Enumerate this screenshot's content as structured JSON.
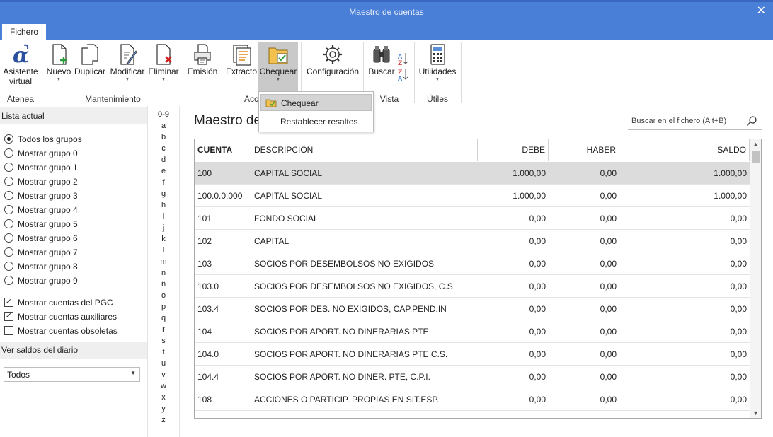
{
  "window": {
    "title": "Maestro de cuentas",
    "close_glyph": "✕"
  },
  "tabs": [
    {
      "label": "Fichero"
    }
  ],
  "ribbon": {
    "groups": {
      "atenea": "Atenea",
      "mantenimiento": "Mantenimiento",
      "acciones": "Acc",
      "vista": "Vista",
      "utiles": "Útiles"
    },
    "buttons": {
      "asistente_line1": "Asistente",
      "asistente_line2": "virtual",
      "nuevo": "Nuevo",
      "duplicar": "Duplicar",
      "modificar": "Modificar",
      "eliminar": "Eliminar",
      "emision": "Emisión",
      "extracto": "Extracto",
      "chequear": "Chequear",
      "configuracion": "Configuración",
      "buscar": "Buscar",
      "utilidades": "Utilidades"
    },
    "dropdown_arrow": "▼"
  },
  "chequear_menu": {
    "items": [
      "Chequear",
      "Restablecer resaltes"
    ]
  },
  "left_panel": {
    "lista_header": "Lista actual",
    "radios": [
      {
        "label": "Todos los grupos",
        "selected": true
      },
      {
        "label": "Mostrar grupo 0",
        "selected": false
      },
      {
        "label": "Mostrar grupo 1",
        "selected": false
      },
      {
        "label": "Mostrar grupo 2",
        "selected": false
      },
      {
        "label": "Mostrar grupo 3",
        "selected": false
      },
      {
        "label": "Mostrar grupo 4",
        "selected": false
      },
      {
        "label": "Mostrar grupo 5",
        "selected": false
      },
      {
        "label": "Mostrar grupo 6",
        "selected": false
      },
      {
        "label": "Mostrar grupo 7",
        "selected": false
      },
      {
        "label": "Mostrar grupo 8",
        "selected": false
      },
      {
        "label": "Mostrar grupo 9",
        "selected": false
      }
    ],
    "checks": [
      {
        "label": "Mostrar cuentas del PGC",
        "checked": true
      },
      {
        "label": "Mostrar cuentas auxiliares",
        "checked": true
      },
      {
        "label": "Mostrar cuentas obsoletas",
        "checked": false
      }
    ],
    "check_mark": "✓",
    "saldos_header": "Ver saldos del diario",
    "saldos_value": "Todos",
    "select_arrow": "▼"
  },
  "alphabet": [
    "0-9",
    "a",
    "b",
    "c",
    "d",
    "e",
    "f",
    "g",
    "h",
    "i",
    "j",
    "k",
    "l",
    "m",
    "n",
    "ñ",
    "o",
    "p",
    "q",
    "r",
    "s",
    "t",
    "u",
    "v",
    "w",
    "x",
    "y",
    "z"
  ],
  "main": {
    "title": "Maestro de",
    "search_placeholder": "Buscar en el fichero (Alt+B)"
  },
  "table": {
    "columns": [
      "CUENTA",
      "DESCRIPCIÓN",
      "DEBE",
      "HABER",
      "SALDO"
    ],
    "rows": [
      [
        "100",
        "CAPITAL SOCIAL",
        "1.000,00",
        "0,00",
        "1.000,00"
      ],
      [
        "100.0.0.000",
        "CAPITAL SOCIAL",
        "1.000,00",
        "0,00",
        "1.000,00"
      ],
      [
        "101",
        "FONDO SOCIAL",
        "0,00",
        "0,00",
        "0,00"
      ],
      [
        "102",
        "CAPITAL",
        "0,00",
        "0,00",
        "0,00"
      ],
      [
        "103",
        "SOCIOS POR DESEMBOLSOS NO EXIGIDOS",
        "0,00",
        "0,00",
        "0,00"
      ],
      [
        "103.0",
        "SOCIOS POR DESEMBOLSOS NO EXIGIDOS, C.S.",
        "0,00",
        "0,00",
        "0,00"
      ],
      [
        "103.4",
        "SOCIOS POR DES. NO EXIGIDOS, CAP.PEND.IN",
        "0,00",
        "0,00",
        "0,00"
      ],
      [
        "104",
        "SOCIOS POR APORT. NO DINERARIAS PTE",
        "0,00",
        "0,00",
        "0,00"
      ],
      [
        "104.0",
        "SOCIOS POR APORT. NO DINERARIAS PTE C.S.",
        "0,00",
        "0,00",
        "0,00"
      ],
      [
        "104.4",
        "SOCIOS POR APORT. NO DINER. PTE, C.P.I.",
        "0,00",
        "0,00",
        "0,00"
      ],
      [
        "108",
        "ACCIONES O PARTICIP. PROPIAS EN SIT.ESP.",
        "0,00",
        "0,00",
        "0,00"
      ]
    ],
    "selected_row": 0,
    "scroll_up": "▲",
    "scroll_down": "▼"
  },
  "colors": {
    "titlebar": "#4a7fd8",
    "accent_green": "#2e9b3a",
    "accent_red": "#d02020",
    "logo_blue": "#2a4f9e"
  }
}
